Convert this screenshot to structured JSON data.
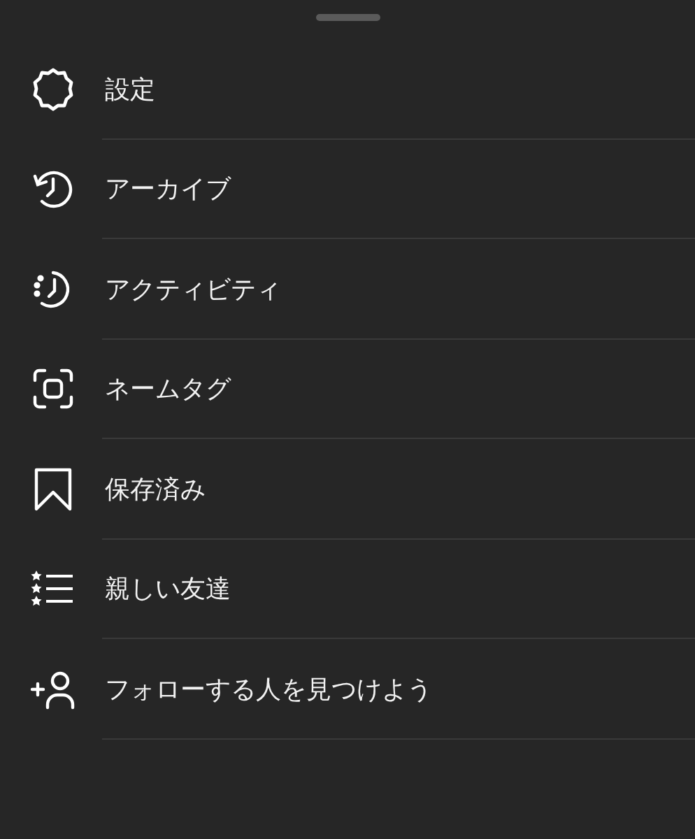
{
  "items": [
    {
      "kind": "settings",
      "label": "設定"
    },
    {
      "kind": "archive",
      "label": "アーカイブ"
    },
    {
      "kind": "activity",
      "label": "アクティビティ"
    },
    {
      "kind": "nametag",
      "label": "ネームタグ"
    },
    {
      "kind": "saved",
      "label": "保存済み"
    },
    {
      "kind": "close_friends",
      "label": "親しい友達"
    },
    {
      "kind": "discover",
      "label": "フォローする人を見つけよう"
    }
  ]
}
